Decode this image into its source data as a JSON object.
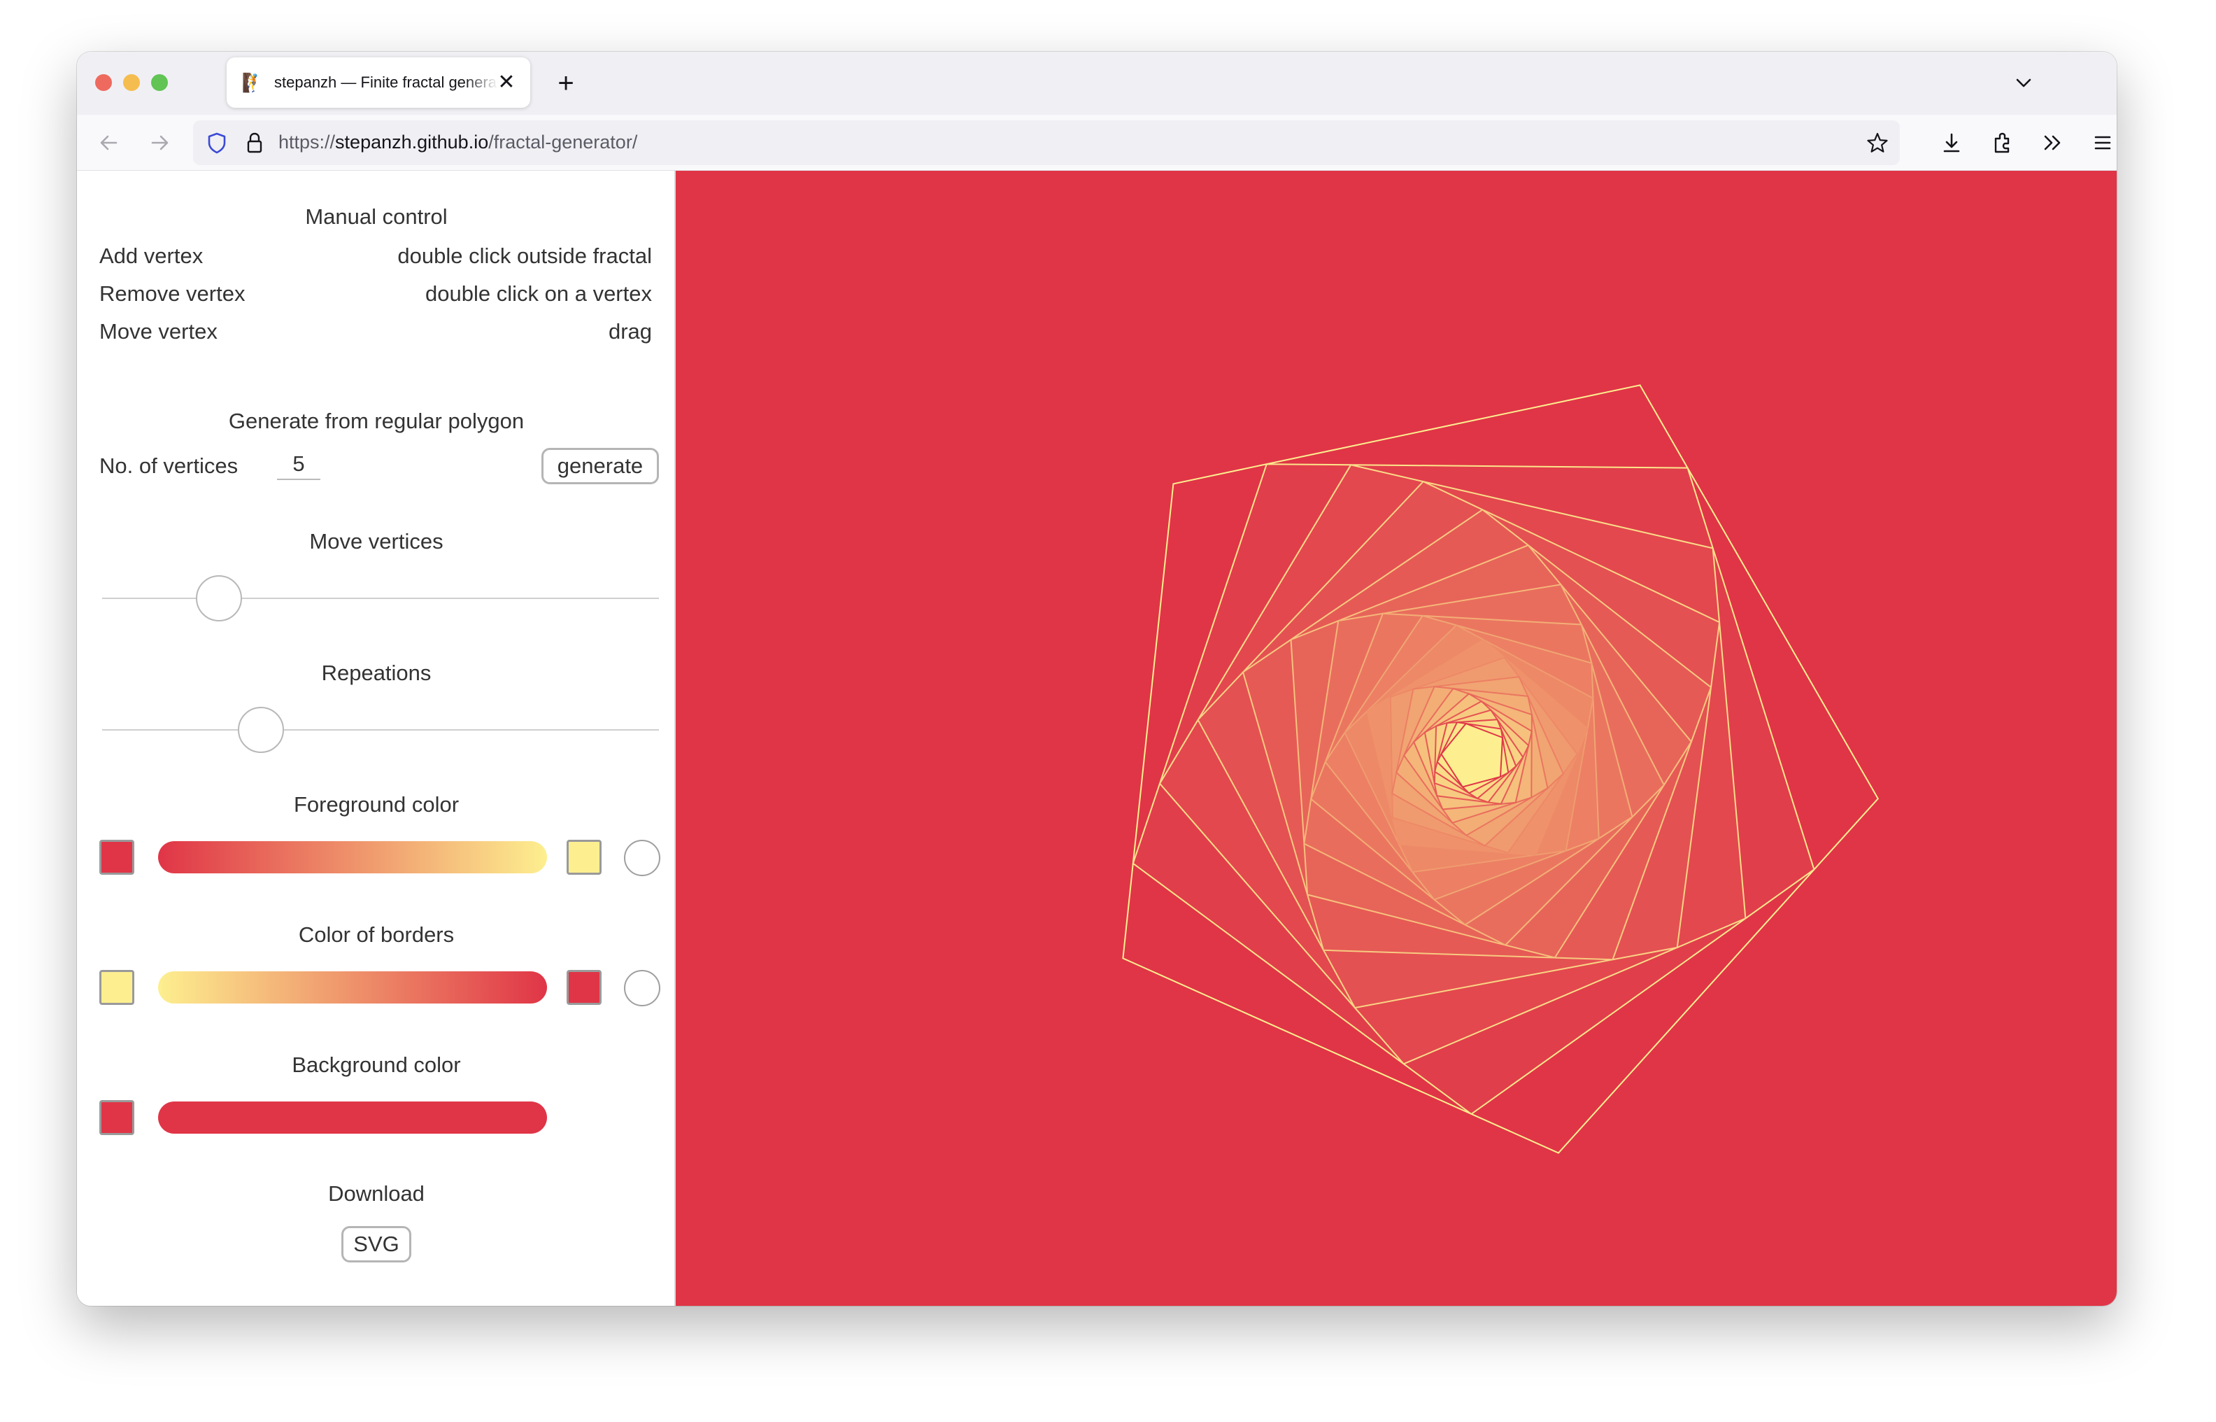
{
  "browser": {
    "tab_title": "stepanzh — Finite fractal generator",
    "favicon": "🧗",
    "tab_close": "✕",
    "new_tab": "+",
    "url_scheme": "https://",
    "url_host": "stepanzh.github.io",
    "url_path": "/fractal-generator/"
  },
  "manual_control": {
    "title": "Manual control",
    "rows": [
      {
        "label": "Add vertex",
        "value": "double click outside fractal"
      },
      {
        "label": "Remove vertex",
        "value": "double click on a vertex"
      },
      {
        "label": "Move vertex",
        "value": "drag"
      }
    ]
  },
  "generate": {
    "title": "Generate from regular polygon",
    "vertices_label": "No. of vertices",
    "vertices_value": "5",
    "button_label": "generate"
  },
  "move_vertices": {
    "title": "Move vertices",
    "level": 0.21
  },
  "repeations": {
    "title": "Repeations",
    "level": 0.285
  },
  "foreground": {
    "title": "Foreground color",
    "start_color": "#e03547",
    "end_color": "#fdef8f"
  },
  "borders": {
    "title": "Color of borders",
    "start_color": "#fdef8f",
    "end_color": "#e03547"
  },
  "background": {
    "title": "Background color",
    "color": "#e03547"
  },
  "download": {
    "title": "Download",
    "svg_label": "SVG"
  },
  "fractal": {
    "vertices": 5,
    "layers": 20
  }
}
